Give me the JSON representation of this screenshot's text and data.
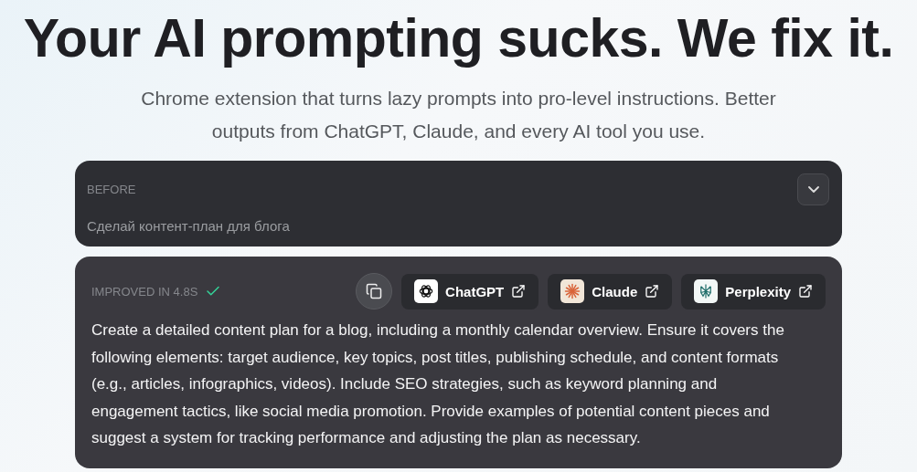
{
  "headline": "Your AI prompting sucks. We fix it.",
  "subtitle": "Chrome extension that turns lazy prompts into pro-level instructions. Better outputs from ChatGPT, Claude, and every AI tool you use.",
  "before": {
    "label": "BEFORE",
    "text": "Сделай контент-план для блога",
    "expanded": false
  },
  "improved": {
    "label": "IMPROVED IN 4.8S",
    "done": true,
    "text": "Create a detailed content plan for a blog, including a monthly calendar overview. Ensure it covers the following elements: target audience, key topics, post titles, publishing schedule, and content formats (e.g., articles, infographics, videos). Include SEO strategies, such as keyword planning and engagement tactics, like social media promotion. Provide examples of potential content pieces and suggest a system for tracking performance and adjusting the plan as necessary."
  },
  "tools": [
    {
      "kind": "chatgpt",
      "label": "ChatGPT"
    },
    {
      "kind": "claude",
      "label": "Claude"
    },
    {
      "kind": "perplexity",
      "label": "Perplexity"
    }
  ]
}
